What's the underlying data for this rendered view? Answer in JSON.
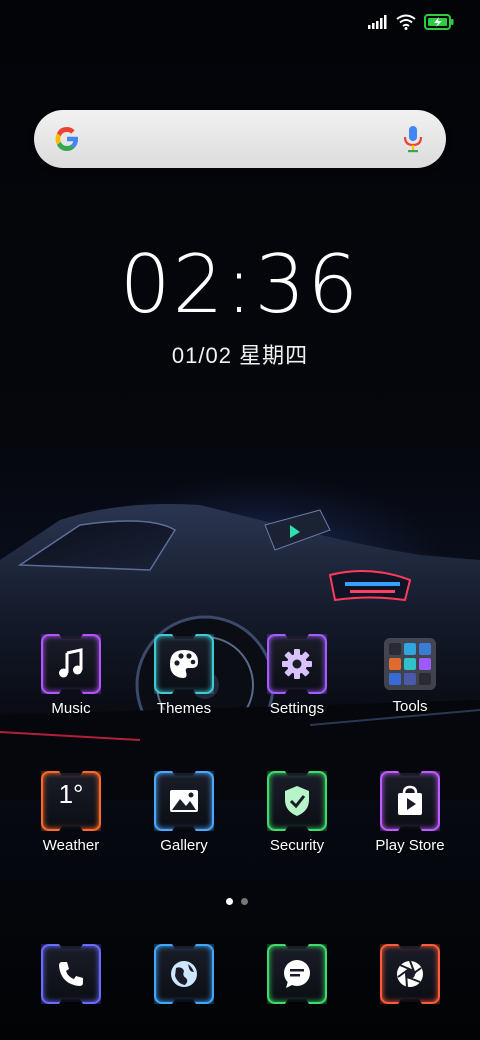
{
  "status_bar": {
    "signal_icon": "signal-bars-icon",
    "wifi_icon": "wifi-icon",
    "battery_icon": "battery-charging-icon",
    "battery_color": "#2ecc40"
  },
  "search": {
    "logo_icon": "google-g-icon",
    "mic_icon": "microphone-icon"
  },
  "clock": {
    "time": "02:36",
    "date": "01/02 星期四"
  },
  "apps": [
    {
      "label": "Music",
      "icon": "music-note-icon",
      "color": "#b455ff"
    },
    {
      "label": "Themes",
      "icon": "palette-icon",
      "color": "#3ecbd6"
    },
    {
      "label": "Settings",
      "icon": "gear-icon",
      "color": "#a35cff"
    },
    {
      "label": "Tools",
      "icon": "folder-grid-icon",
      "color": "#a0a0aa"
    },
    {
      "label": "Weather",
      "icon": "weather-icon",
      "value": "1°",
      "color": "#ff6a2a"
    },
    {
      "label": "Gallery",
      "icon": "image-icon",
      "color": "#4aa8ff"
    },
    {
      "label": "Security",
      "icon": "shield-check-icon",
      "color": "#3edc6a"
    },
    {
      "label": "Play Store",
      "icon": "play-store-icon",
      "color": "#c05cff"
    }
  ],
  "pager": {
    "pages": 2,
    "active": 1
  },
  "dock": [
    {
      "icon": "phone-icon",
      "color": "#6a6bff"
    },
    {
      "icon": "browser-globe-icon",
      "color": "#3ea8ff"
    },
    {
      "icon": "message-icon",
      "color": "#3edc6a"
    },
    {
      "icon": "camera-shutter-icon",
      "color": "#ff5a3a"
    }
  ]
}
